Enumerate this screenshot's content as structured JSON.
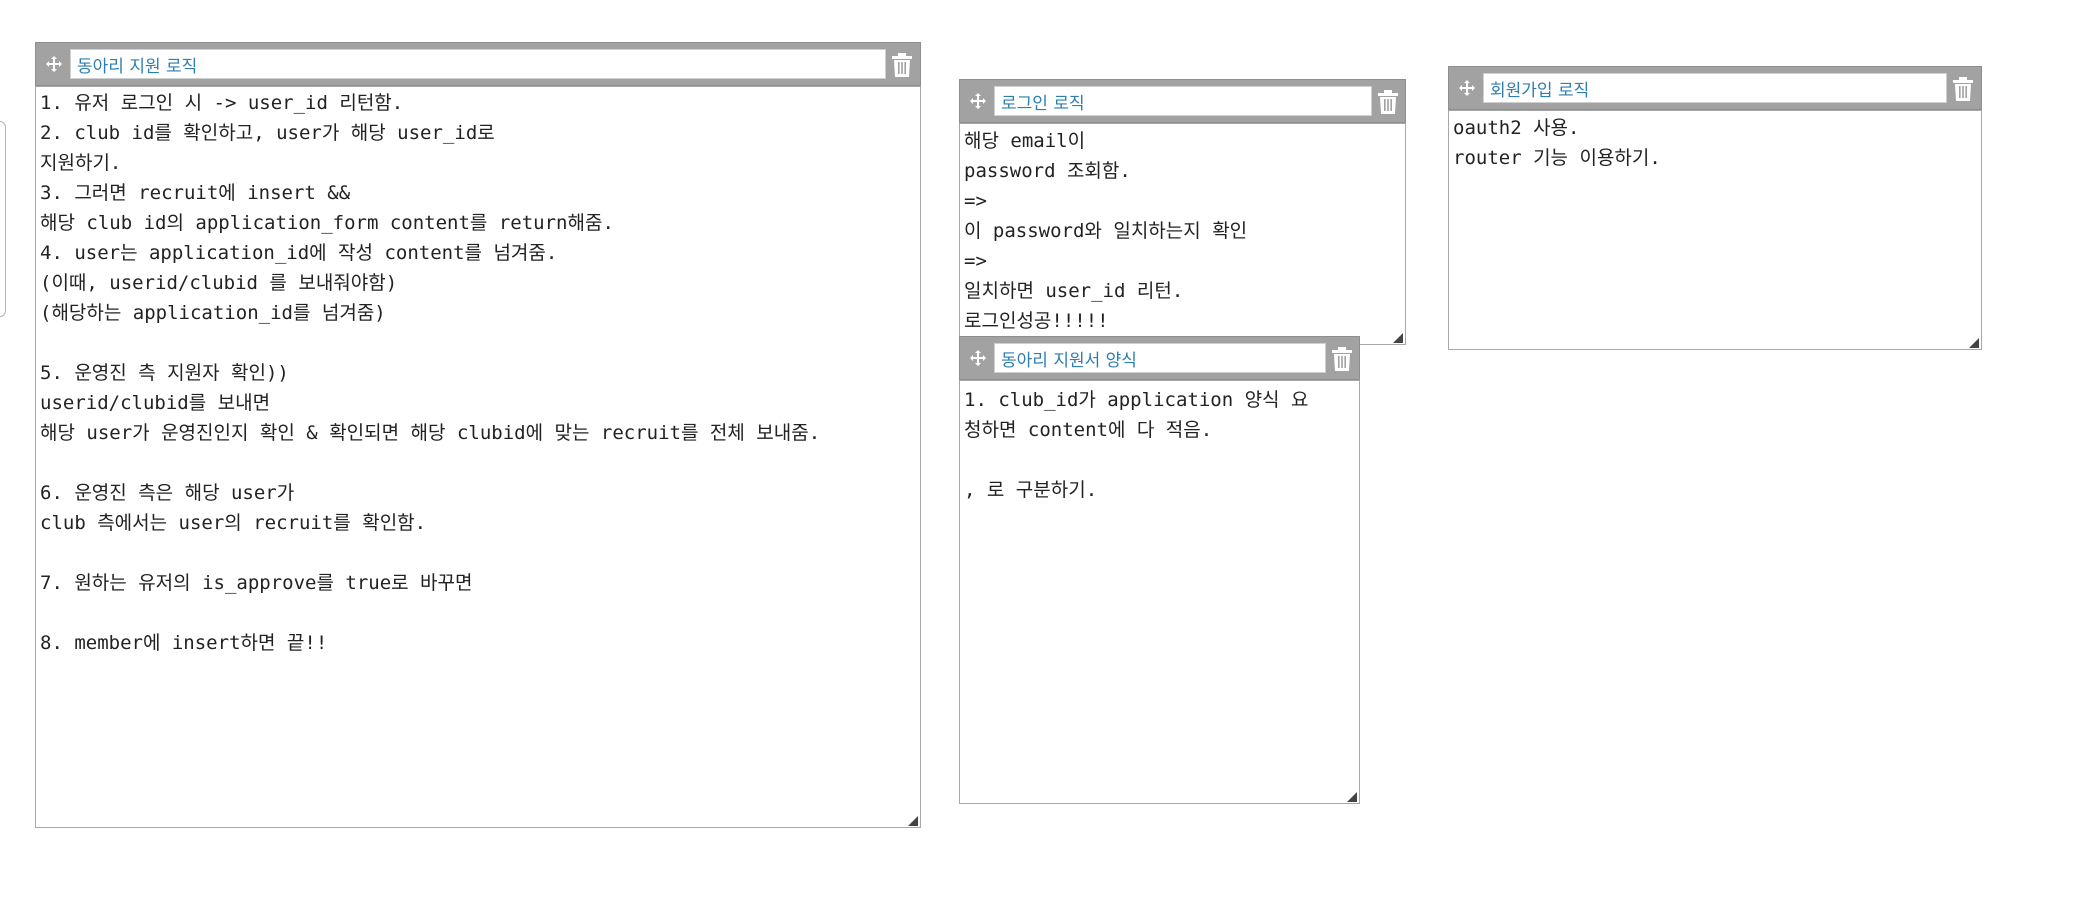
{
  "memos": [
    {
      "title": "동아리 지원 로직",
      "body": "1. 유저 로그인 시 -> user_id 리턴함.\n2. club id를 확인하고, user가 해당 user_id로\n지원하기.\n3. 그러면 recruit에 insert &&\n해당 club id의 application_form content를 return해줌.\n4. user는 application_id에 작성 content를 넘겨줌.\n(이때, userid/clubid 를 보내줘야함)\n(해당하는 application_id를 넘겨줌)\n\n5. 운영진 측 지원자 확인))\nuserid/clubid를 보내면\n해당 user가 운영진인지 확인 & 확인되면 해당 clubid에 맞는 recruit를 전체 보내줌.\n\n6. 운영진 측은 해당 user가\nclub 측에서는 user의 recruit를 확인함.\n\n7. 원하는 유저의 is_approve를 true로 바꾸면\n\n8. member에 insert하면 끝!!"
    },
    {
      "title": "로그인 로직",
      "body": "해당 email이\npassword 조회함.\n=>\n이 password와 일치하는지 확인\n=>\n일치하면 user_id 리턴.\n로그인성공!!!!!"
    },
    {
      "title": "동아리 지원서 양식",
      "body": "1. club_id가 application 양식 요\n청하면 content에 다 적음.\n\n, 로 구분하기."
    },
    {
      "title": "회원가입 로직",
      "body": "oauth2 사용.\nrouter 기능 이용하기."
    }
  ],
  "icons": {
    "move": "move-arrows-icon",
    "delete": "trash-icon",
    "resize": "resize-grip-icon"
  }
}
